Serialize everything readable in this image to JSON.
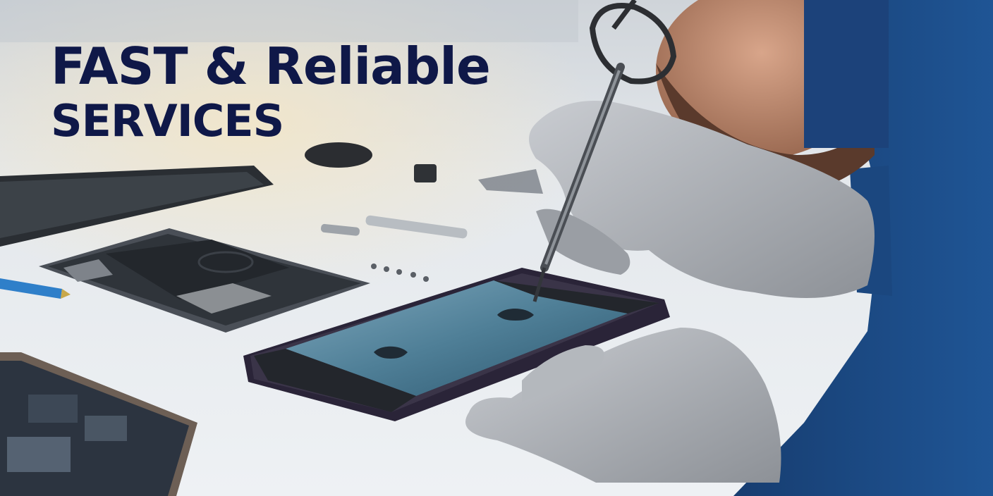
{
  "banner": {
    "headline_line1": "FAST & Reliable",
    "headline_line2": "SERVICES"
  },
  "colors": {
    "headline": "#0f1848",
    "desk": "#e6eaee",
    "glove": "#a9adb3",
    "shirt": "#1d4a86",
    "screen": "#3d6d86"
  }
}
